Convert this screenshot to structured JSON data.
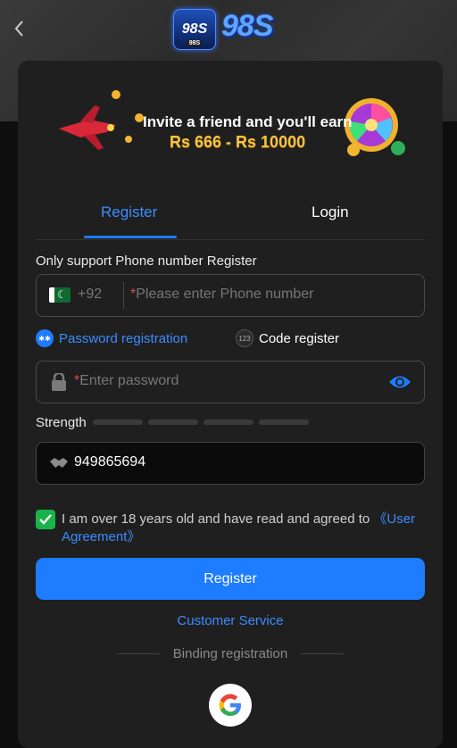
{
  "brand": {
    "logo_badge": "98S",
    "logo_badge_sub": "98S",
    "logo_word": "98S"
  },
  "banner": {
    "line1": "Invite a friend and you'll earn",
    "line2": "Rs 666 - Rs 10000"
  },
  "tabs": {
    "register": "Register",
    "login": "Login"
  },
  "form": {
    "note": "Only support Phone number Register",
    "phone": {
      "country_code": "+92",
      "required_mark": "*",
      "placeholder": "Please enter Phone number"
    },
    "options": {
      "password_registration": "Password registration",
      "code_register": "Code register",
      "code_badge": "123"
    },
    "password": {
      "required_mark": "*",
      "placeholder": "Enter password"
    },
    "strength_label": "Strength",
    "invite_code": "949865694",
    "agreement": {
      "text": "I am over 18 years old and have read and agreed to ",
      "link": "《User Agreement》"
    },
    "submit": "Register"
  },
  "footer": {
    "customer_service": "Customer Service",
    "binding": "Binding registration"
  },
  "colors": {
    "accent": "#1e7cff",
    "check": "#19b34a",
    "required": "#e14b4b"
  }
}
